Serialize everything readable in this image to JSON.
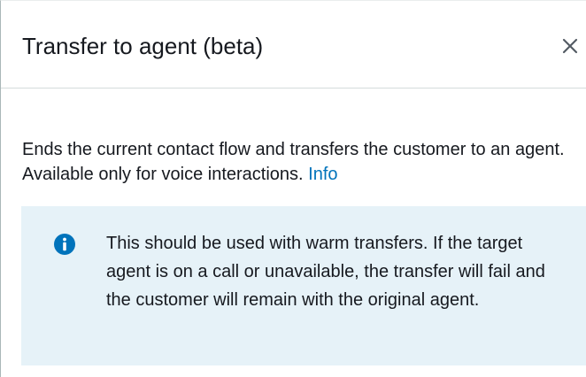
{
  "panel": {
    "title": "Transfer to agent (beta)",
    "close_icon": "close-icon"
  },
  "description": {
    "text": "Ends the current contact flow and transfers the customer to an agent. Available only for voice interactions.",
    "info_link": "Info"
  },
  "alert": {
    "icon": "info-icon",
    "text": "This should be used with warm transfers. If the target agent is on a call or unavailable, the transfer will fail and the customer will remain with the original agent."
  },
  "colors": {
    "link": "#0073bb",
    "alert_background": "#e6f2f8",
    "info_icon": "#0073bb",
    "text": "#16191f"
  }
}
